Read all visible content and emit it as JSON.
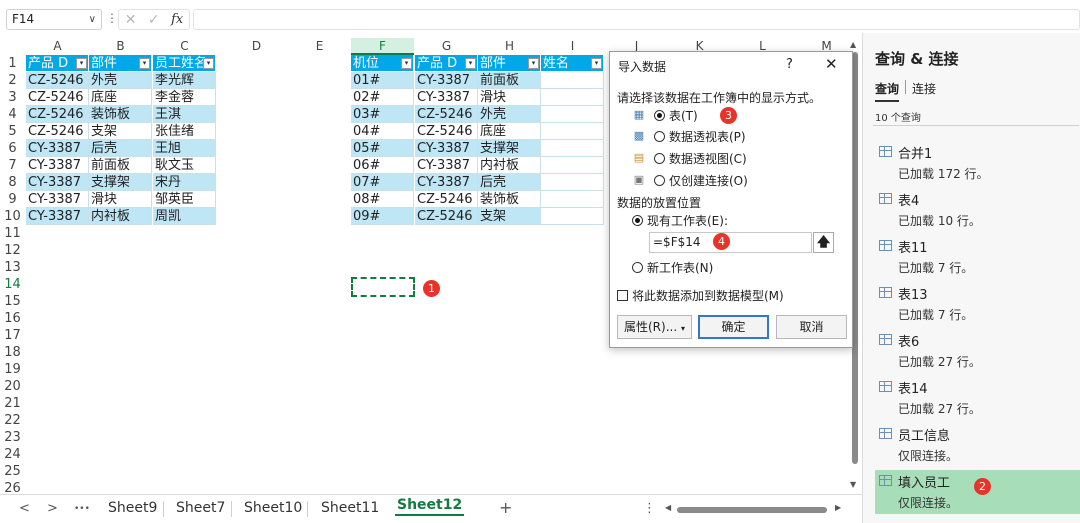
{
  "formula_bar": {
    "name_box": "F14",
    "fx_label": "fx",
    "formula": ""
  },
  "columns": [
    "A",
    "B",
    "C",
    "D",
    "E",
    "F",
    "G",
    "H",
    "I",
    "J",
    "K",
    "L",
    "M"
  ],
  "selected_column": "F",
  "rows": [
    "1",
    "2",
    "3",
    "4",
    "5",
    "6",
    "7",
    "8",
    "9",
    "10",
    "11",
    "12",
    "13",
    "14",
    "15",
    "16",
    "17",
    "18",
    "19",
    "20",
    "21",
    "22",
    "23",
    "24",
    "25",
    "26"
  ],
  "selected_row": "14",
  "table1": {
    "headers": [
      "产品 D",
      "部件",
      "员工姓名"
    ],
    "rows": [
      [
        "CZ-5246",
        "外壳",
        "李光辉"
      ],
      [
        "CZ-5246",
        "底座",
        "李金蓉"
      ],
      [
        "CZ-5246",
        "装饰板",
        "王淇"
      ],
      [
        "CZ-5246",
        "支架",
        "张佳绪"
      ],
      [
        "CY-3387",
        "后壳",
        "王旭"
      ],
      [
        "CY-3387",
        "前面板",
        "耿文玉"
      ],
      [
        "CY-3387",
        "支撑架",
        "宋丹"
      ],
      [
        "CY-3387",
        "滑块",
        "邹英臣"
      ],
      [
        "CY-3387",
        "内衬板",
        "周凯"
      ]
    ]
  },
  "table2": {
    "headers": [
      "机位",
      "产品 D",
      "部件",
      "姓名"
    ],
    "rows": [
      [
        "01#",
        "CY-3387",
        "前面板",
        ""
      ],
      [
        "02#",
        "CY-3387",
        "滑块",
        ""
      ],
      [
        "03#",
        "CZ-5246",
        "外壳",
        ""
      ],
      [
        "04#",
        "CZ-5246",
        "底座",
        ""
      ],
      [
        "05#",
        "CY-3387",
        "支撑架",
        ""
      ],
      [
        "06#",
        "CY-3387",
        "内衬板",
        ""
      ],
      [
        "07#",
        "CY-3387",
        "后壳",
        ""
      ],
      [
        "08#",
        "CZ-5246",
        "装饰板",
        ""
      ],
      [
        "09#",
        "CZ-5246",
        "支架",
        ""
      ]
    ]
  },
  "badges": {
    "b1": "1",
    "b2": "2",
    "b3": "3",
    "b4": "4"
  },
  "sheet_tabs": [
    "Sheet9",
    "Sheet7",
    "Sheet10",
    "Sheet11",
    "Sheet12"
  ],
  "active_sheet": "Sheet12",
  "tab_nav": {
    "prev": "<",
    "next": ">",
    "more": "•••",
    "add": "+",
    "menu": "⋮"
  },
  "dialog": {
    "title": "导入数据",
    "help": "?",
    "close": "✕",
    "prompt": "请选择该数据在工作簿中的显示方式。",
    "view_options": [
      {
        "label": "表(T)",
        "icon": "table-icon",
        "selected": true
      },
      {
        "label": "数据透视表(P)",
        "icon": "pivot-table-icon",
        "selected": false
      },
      {
        "label": "数据透视图(C)",
        "icon": "pivot-chart-icon",
        "selected": false
      },
      {
        "label": "仅创建连接(O)",
        "icon": "connection-icon",
        "selected": false
      }
    ],
    "placement_label": "数据的放置位置",
    "existing_sheet": "现有工作表(E):",
    "reference": "=$F$14",
    "new_sheet": "新工作表(N)",
    "add_to_model": "将此数据添加到数据模型(M)",
    "properties_btn": "属性(R)...",
    "ok_btn": "确定",
    "cancel_btn": "取消"
  },
  "query_panel": {
    "title": "查询 & 连接",
    "tab_queries": "查询",
    "tab_connections": "连接",
    "count": "10 个查询",
    "items": [
      {
        "name": "合并1",
        "status": "已加载 172 行。"
      },
      {
        "name": "表4",
        "status": "已加载 10 行。"
      },
      {
        "name": "表11",
        "status": "已加载 7 行。"
      },
      {
        "name": "表13",
        "status": "已加载 7 行。"
      },
      {
        "name": "表6",
        "status": "已加载 27 行。"
      },
      {
        "name": "表14",
        "status": "已加载 27 行。"
      },
      {
        "name": "员工信息",
        "status": "仅限连接。"
      },
      {
        "name": "填入员工",
        "status": "仅限连接。"
      }
    ],
    "selected_item": "填入员工"
  },
  "colors": {
    "accent": "#107c41",
    "table_header": "#00a8e8",
    "table_band": "#bee6f5",
    "badge": "#e8332b",
    "query_selected": "#a7ddb8"
  }
}
